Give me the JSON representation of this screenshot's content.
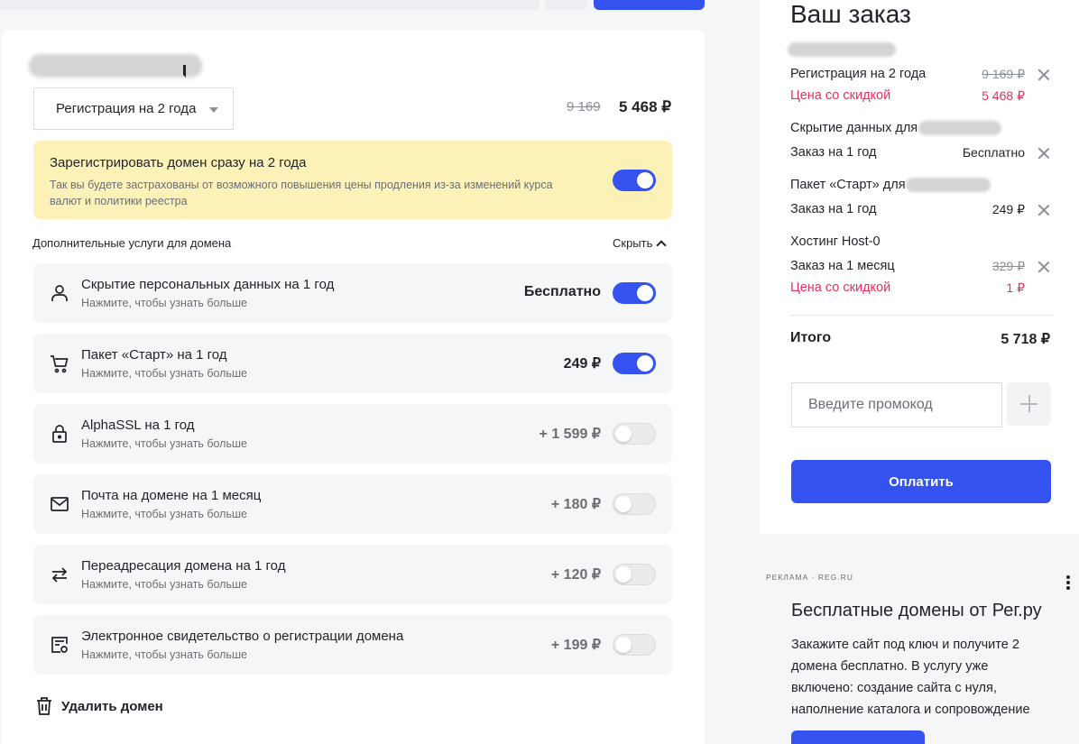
{
  "colors": {
    "accent": "#3352f0",
    "discount_red": "#e8305b",
    "banner_yellow": "#fcf2b8"
  },
  "domain_card": {
    "period_select": {
      "selected": "Регистрация на 2 года"
    },
    "price_old": "9 169",
    "price_new": "5 468 ₽",
    "banner": {
      "title": "Зарегистрировать домен сразу на 2 года",
      "description": "Так вы будете застрахованы от возможного повышения цены продления из-за изменений курса валют и политики реестра",
      "enabled": true
    },
    "services_heading": "Дополнительные услуги для домена",
    "hide_label": "Скрыть",
    "services": [
      {
        "icon": "person-icon",
        "title": "Скрытие персональных данных на 1 год",
        "subtitle": "Нажмите, чтобы узнать больше",
        "price": "Бесплатно",
        "enabled": true
      },
      {
        "icon": "cart-icon",
        "title": "Пакет «Старт» на 1 год",
        "subtitle": "Нажмите, чтобы узнать больше",
        "price": "249 ₽",
        "enabled": true
      },
      {
        "icon": "lock-icon",
        "title": "AlphaSSL на 1 год",
        "subtitle": "Нажмите, чтобы узнать больше",
        "price": "+ 1 599 ₽",
        "enabled": false
      },
      {
        "icon": "mail-icon",
        "title": "Почта на домене на 1 месяц",
        "subtitle": "Нажмите, чтобы узнать больше",
        "price": "+ 180 ₽",
        "enabled": false
      },
      {
        "icon": "redirect-icon",
        "title": "Переадресация домена на 1 год",
        "subtitle": "Нажмите, чтобы узнать больше",
        "price": "+ 120 ₽",
        "enabled": false
      },
      {
        "icon": "certificate-icon",
        "title": "Электронное свидетельство о регистрации домена",
        "subtitle": "Нажмите, чтобы узнать больше",
        "price": "+ 199 ₽",
        "enabled": false
      }
    ],
    "delete_label": "Удалить домен"
  },
  "order": {
    "title": "Ваш заказ",
    "items": [
      {
        "name": "Регистрация на 2 года",
        "price_old": "9 169 ₽",
        "discount_label": "Цена со скидкой",
        "discount_price": "5 468 ₽"
      },
      {
        "name": "Скрытие данных для",
        "period": "Заказ на 1 год",
        "price": "Бесплатно"
      },
      {
        "name": "Пакет «Старт» для",
        "period": "Заказ на 1 год",
        "price": "249 ₽"
      },
      {
        "name": "Хостинг Host-0",
        "period": "Заказ на 1 месяц",
        "price_old": "329 ₽",
        "discount_label": "Цена со скидкой",
        "discount_price": "1 ₽"
      }
    ],
    "total_label": "Итого",
    "total_value": "5 718 ₽",
    "promo_placeholder": "Введите промокод",
    "pay_label": "Оплатить"
  },
  "ad": {
    "tag": "РЕКЛАМА · REG.RU",
    "title": "Бесплатные домены от Рег.ру",
    "text": "Закажите сайт под ключ и получите 2 домена бесплатно. В услугу уже включено: создание сайта с нуля, наполнение каталога и сопровождение"
  }
}
